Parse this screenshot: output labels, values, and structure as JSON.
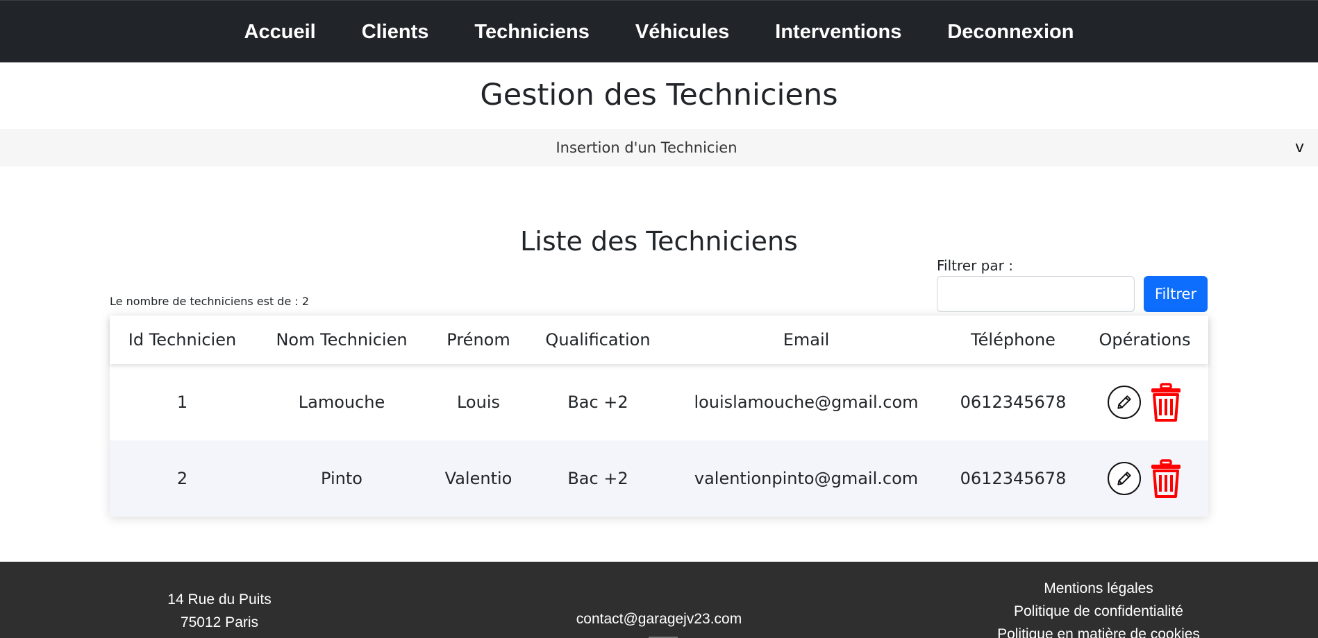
{
  "nav": {
    "items": [
      "Accueil",
      "Clients",
      "Techniciens",
      "Véhicules",
      "Interventions",
      "Deconnexion"
    ]
  },
  "page": {
    "title": "Gestion des Techniciens"
  },
  "accordion": {
    "label": "Insertion d'un Technicien",
    "chevron": "v"
  },
  "list": {
    "title": "Liste des Techniciens",
    "count_label": "Le nombre de techniciens est de : 2"
  },
  "filter": {
    "label": "Filtrer par :",
    "value": "",
    "button": "Filtrer"
  },
  "table": {
    "headers": [
      "Id Technicien",
      "Nom Technicien",
      "Prénom",
      "Qualification",
      "Email",
      "Téléphone",
      "Opérations"
    ],
    "rows": [
      [
        "1",
        "Lamouche",
        "Louis",
        "Bac +2",
        "louislamouche@gmail.com",
        "0612345678"
      ],
      [
        "2",
        "Pinto",
        "Valentio",
        "Bac +2",
        "valentionpinto@gmail.com",
        "0612345678"
      ]
    ],
    "row_actions": [
      "pencil-icon",
      "trash-icon"
    ]
  },
  "footer": {
    "address": [
      "14 Rue du Puits",
      "75012 Paris"
    ],
    "email": "contact@garagejv23.com",
    "links": [
      "Mentions légales",
      "Politique de confidentialité",
      "Politique en matière de cookies"
    ]
  },
  "colors": {
    "nav_bg": "#212529",
    "footer_bg": "#2f2f2f",
    "accent": "#0d6efd",
    "delete": "#ff0000"
  }
}
